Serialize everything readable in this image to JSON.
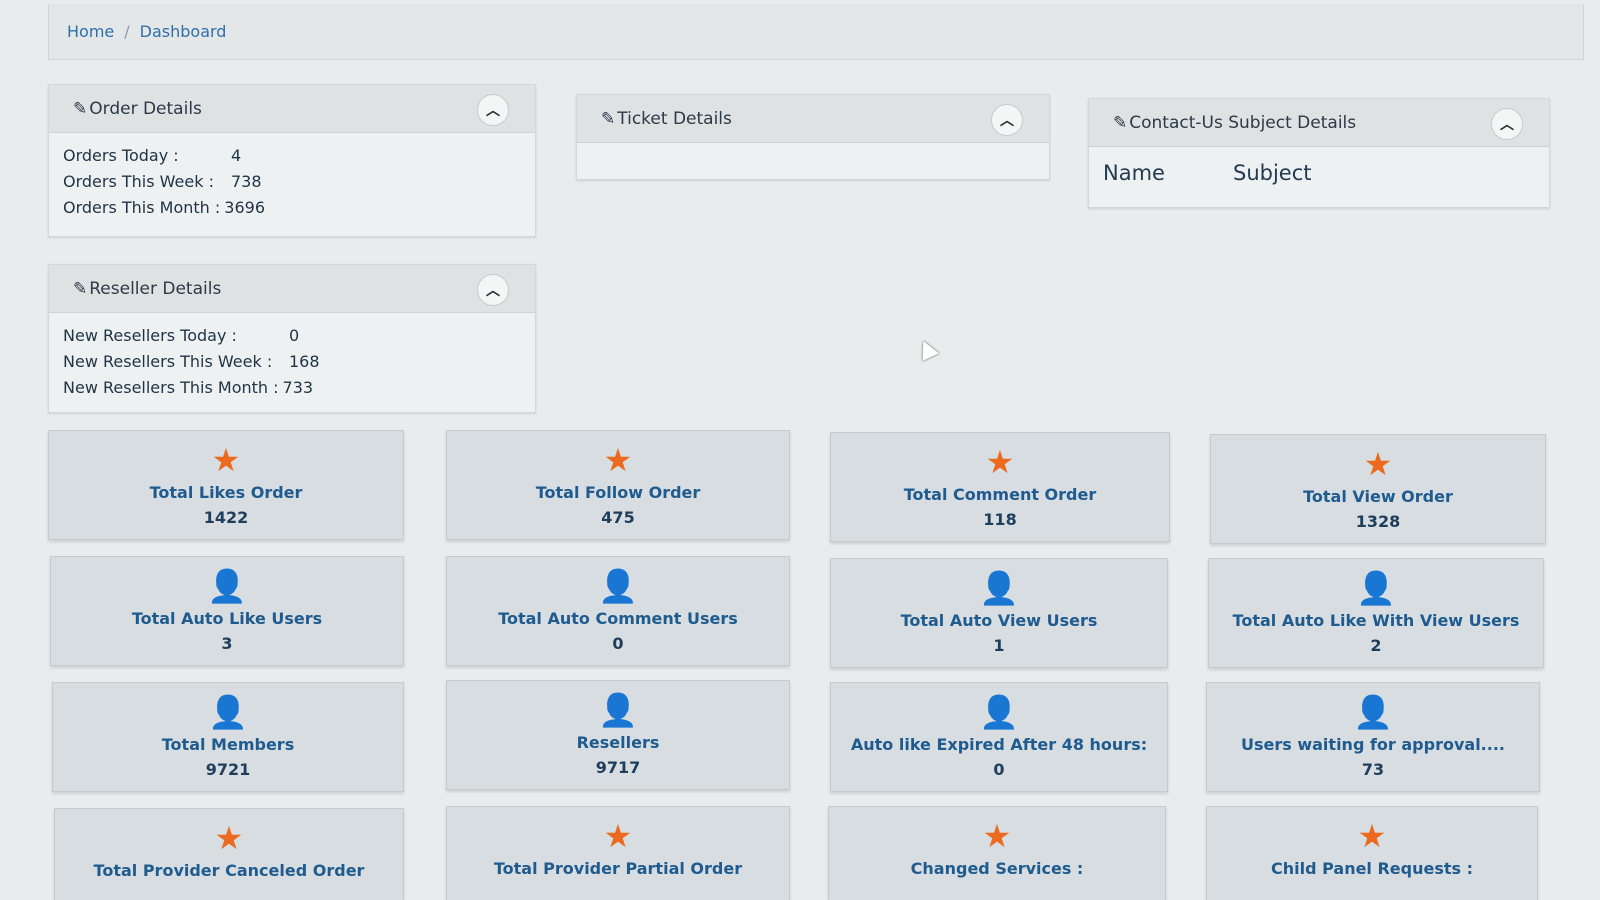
{
  "breadcrumb": {
    "home": "Home",
    "separator": "/",
    "current": "Dashboard"
  },
  "order_details": {
    "title": "Order Details",
    "rows": [
      {
        "label": "Orders Today :",
        "value": "4"
      },
      {
        "label": "Orders This Week :",
        "value": "738"
      },
      {
        "label": "Orders This Month :",
        "value": "3696"
      }
    ]
  },
  "ticket_details": {
    "title": "Ticket Details"
  },
  "contact_details": {
    "title": "Contact-Us Subject Details",
    "col_name": "Name",
    "col_subject": "Subject"
  },
  "reseller_details": {
    "title": "Reseller Details",
    "rows": [
      {
        "label": "New Resellers Today :",
        "value": "0"
      },
      {
        "label": "New Resellers This Week :",
        "value": "168"
      },
      {
        "label": "New Resellers This Month :",
        "value": "733"
      }
    ]
  },
  "icons": {
    "edit": "edit-icon",
    "collapse": "chevron-up-icon",
    "star": "star-icon",
    "user": "user-icon"
  },
  "colors": {
    "star": "#ec6a1e",
    "user": "#1c5ea0",
    "tile_text": "#1f5b8f"
  },
  "tiles": [
    {
      "icon": "star",
      "label": "Total Likes Order",
      "value": "1422"
    },
    {
      "icon": "star",
      "label": "Total Follow Order",
      "value": "475"
    },
    {
      "icon": "star",
      "label": "Total Comment Order",
      "value": "118"
    },
    {
      "icon": "star",
      "label": "Total View Order",
      "value": "1328"
    },
    {
      "icon": "user",
      "label": "Total Auto Like Users",
      "value": "3"
    },
    {
      "icon": "user",
      "label": "Total Auto Comment Users",
      "value": "0"
    },
    {
      "icon": "user",
      "label": "Total Auto View Users",
      "value": "1"
    },
    {
      "icon": "user",
      "label": "Total Auto Like With View Users",
      "value": "2"
    },
    {
      "icon": "user",
      "label": "Total Members",
      "value": "9721"
    },
    {
      "icon": "user",
      "label": "Resellers",
      "value": "9717"
    },
    {
      "icon": "user",
      "label": "Auto like Expired After 48 hours:",
      "value": "0"
    },
    {
      "icon": "user",
      "label": "Users waiting for approval....",
      "value": "73"
    },
    {
      "icon": "star",
      "label": "Total Provider Canceled Order",
      "value": ""
    },
    {
      "icon": "star",
      "label": "Total Provider Partial Order",
      "value": ""
    },
    {
      "icon": "star",
      "label": "Changed Services :",
      "value": ""
    },
    {
      "icon": "star",
      "label": "Child Panel Requests :",
      "value": ""
    }
  ]
}
